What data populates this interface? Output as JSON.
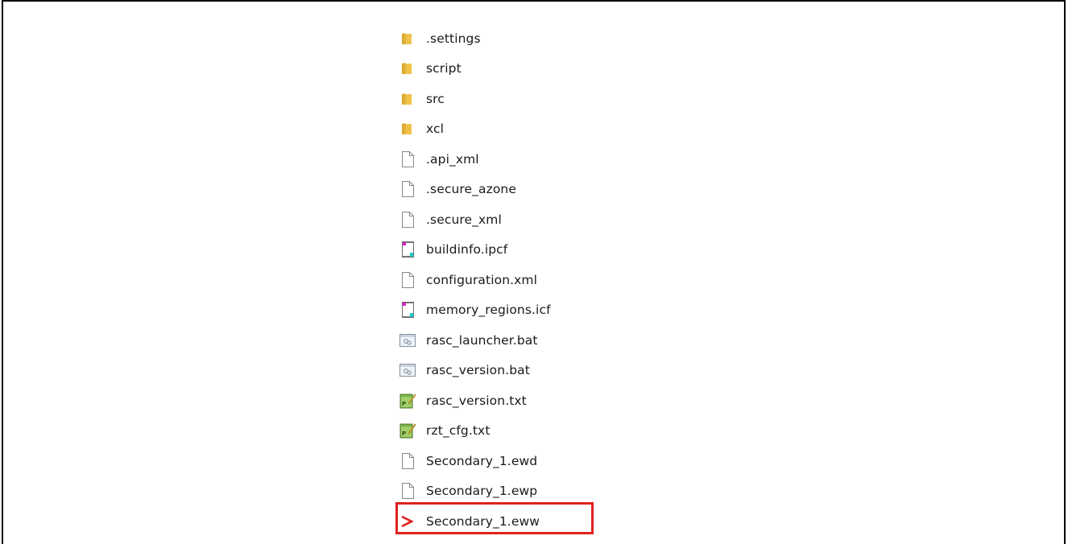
{
  "files": [
    {
      "name": ".settings",
      "icon": "folder-icon"
    },
    {
      "name": "script",
      "icon": "folder-icon"
    },
    {
      "name": "src",
      "icon": "folder-icon"
    },
    {
      "name": "xcl",
      "icon": "folder-icon"
    },
    {
      "name": ".api_xml",
      "icon": "blank-file-icon"
    },
    {
      "name": ".secure_azone",
      "icon": "blank-file-icon"
    },
    {
      "name": ".secure_xml",
      "icon": "blank-file-icon"
    },
    {
      "name": "buildinfo.ipcf",
      "icon": "linker-config-file-icon"
    },
    {
      "name": "configuration.xml",
      "icon": "blank-file-icon"
    },
    {
      "name": "memory_regions.icf",
      "icon": "linker-config-file-icon"
    },
    {
      "name": "rasc_launcher.bat",
      "icon": "batch-file-icon"
    },
    {
      "name": "rasc_version.bat",
      "icon": "batch-file-icon"
    },
    {
      "name": "rasc_version.txt",
      "icon": "text-editor-file-icon"
    },
    {
      "name": "rzt_cfg.txt",
      "icon": "text-editor-file-icon"
    },
    {
      "name": "Secondary_1.ewd",
      "icon": "blank-file-icon"
    },
    {
      "name": "Secondary_1.ewp",
      "icon": "blank-file-icon"
    },
    {
      "name": "Secondary_1.eww",
      "icon": "iar-workspace-icon"
    }
  ],
  "highlight": {
    "color": "#e0201f",
    "target": "Secondary_1.eww"
  },
  "colors": {
    "folder": "#e8b93a",
    "folder_dark": "#d9a82a",
    "highlight": "#e0201f"
  }
}
